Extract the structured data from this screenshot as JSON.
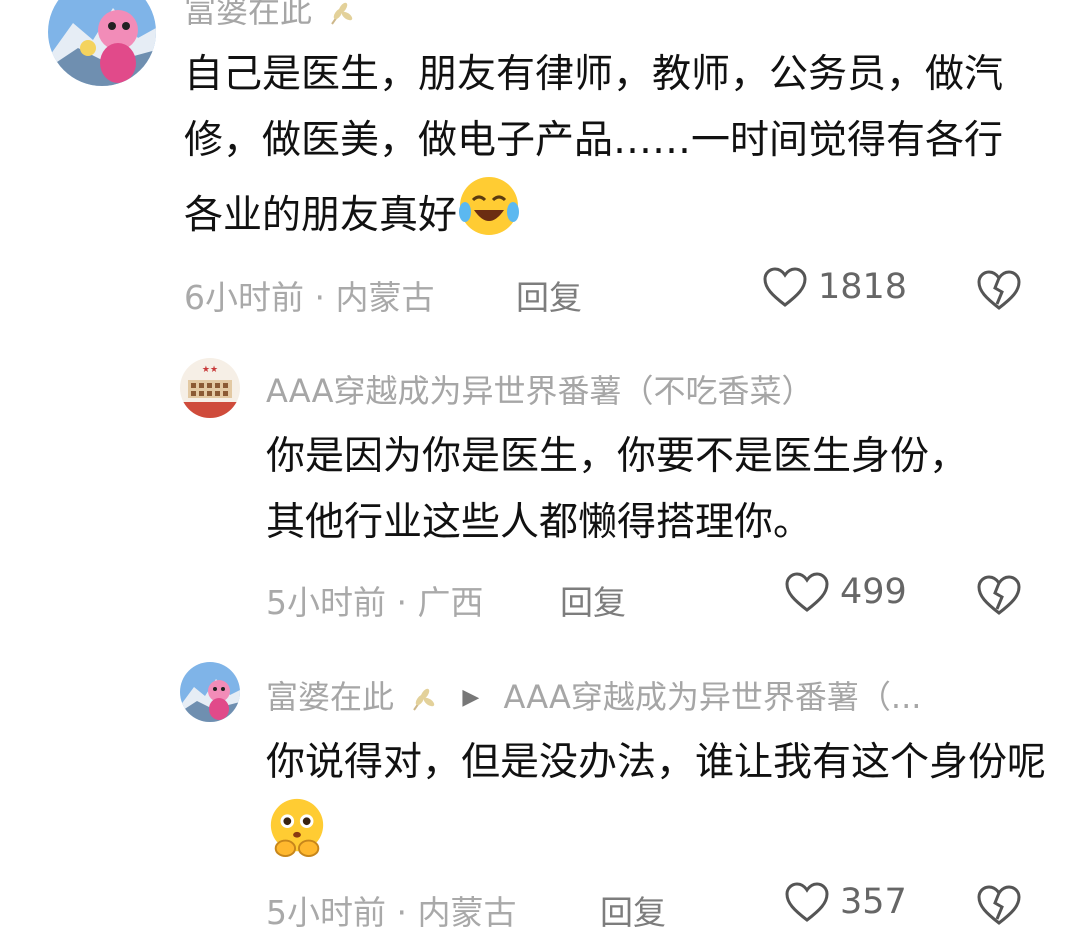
{
  "comments": [
    {
      "author": "富婆在此",
      "text": "自己是医生，朋友有律师，教师，公务员，做汽修，做医美，做电子产品……一时间觉得有各行各业的朋友真好",
      "emoji": "crying-laughing-emoji",
      "time_location": "6小时前 · 内蒙古",
      "reply_label": "回复",
      "likes": "1818"
    },
    {
      "author": "AAA穿越成为异世界番薯（不吃香菜）",
      "text": "你是因为你是医生，你要不是医生身份，其他行业这些人都懒得搭理你。",
      "time_location": "5小时前 · 广西",
      "reply_label": "回复",
      "likes": "499"
    },
    {
      "author": "富婆在此",
      "reply_to": "AAA穿越成为异世界番薯（...",
      "text": "你说得对，但是没办法，谁让我有这个身份呢",
      "emoji": "pleading-face-emoji",
      "time_location": "5小时前 · 内蒙古",
      "reply_label": "回复",
      "likes": "357"
    }
  ],
  "colors": {
    "meta": "#a9a9a9",
    "name": "#a6a6a6",
    "text": "#111111"
  }
}
